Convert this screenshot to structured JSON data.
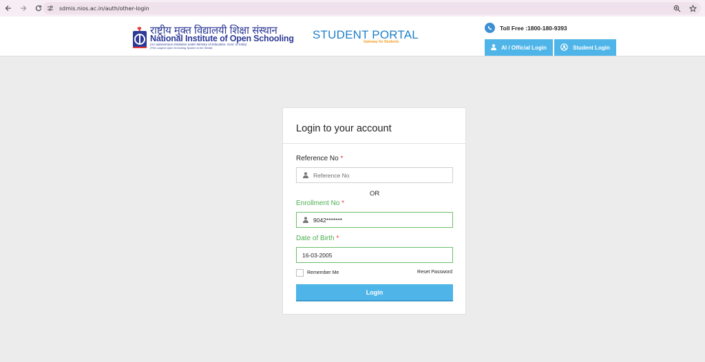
{
  "browser": {
    "url": "sdmis.nios.ac.in/auth/other-login"
  },
  "header": {
    "logo_hindi": "राष्ट्रीय मुक्त विद्यालयी शिक्षा संस्थान",
    "logo_eng_1": "National Institute of ",
    "logo_eng_2": "Open Schooling",
    "logo_sub1": "(An autonomous Institution under Ministry of Education, Govt. of India)",
    "logo_sub2": "(The Largest Open Schooling System in the World)",
    "portal_title": "STUDENT PORTAL",
    "portal_subtitle": "Gateway for Students",
    "toll_free": "Toll Free :1800-180-9393",
    "official_login_label": "AI / Official Login",
    "student_login_label": "Student Login",
    "colors": {
      "primary_blue": "#4fb5e8",
      "brand_navy": "#2c3996"
    }
  },
  "login": {
    "title": "Login to your account",
    "reference_label": "Reference No",
    "reference_placeholder": "Reference No",
    "reference_value": "",
    "or_text": "OR",
    "enrollment_label": "Enrollment No",
    "enrollment_value": "9042*******",
    "dob_label": "Date of Birth",
    "dob_value": "16-03-2005",
    "required_mark": "*",
    "remember_label": "Remember Me",
    "remember_checked": false,
    "reset_label": "Reset Password",
    "login_button": "Login",
    "colors": {
      "valid_green": "#4caf50",
      "required_red": "#e53935"
    }
  }
}
